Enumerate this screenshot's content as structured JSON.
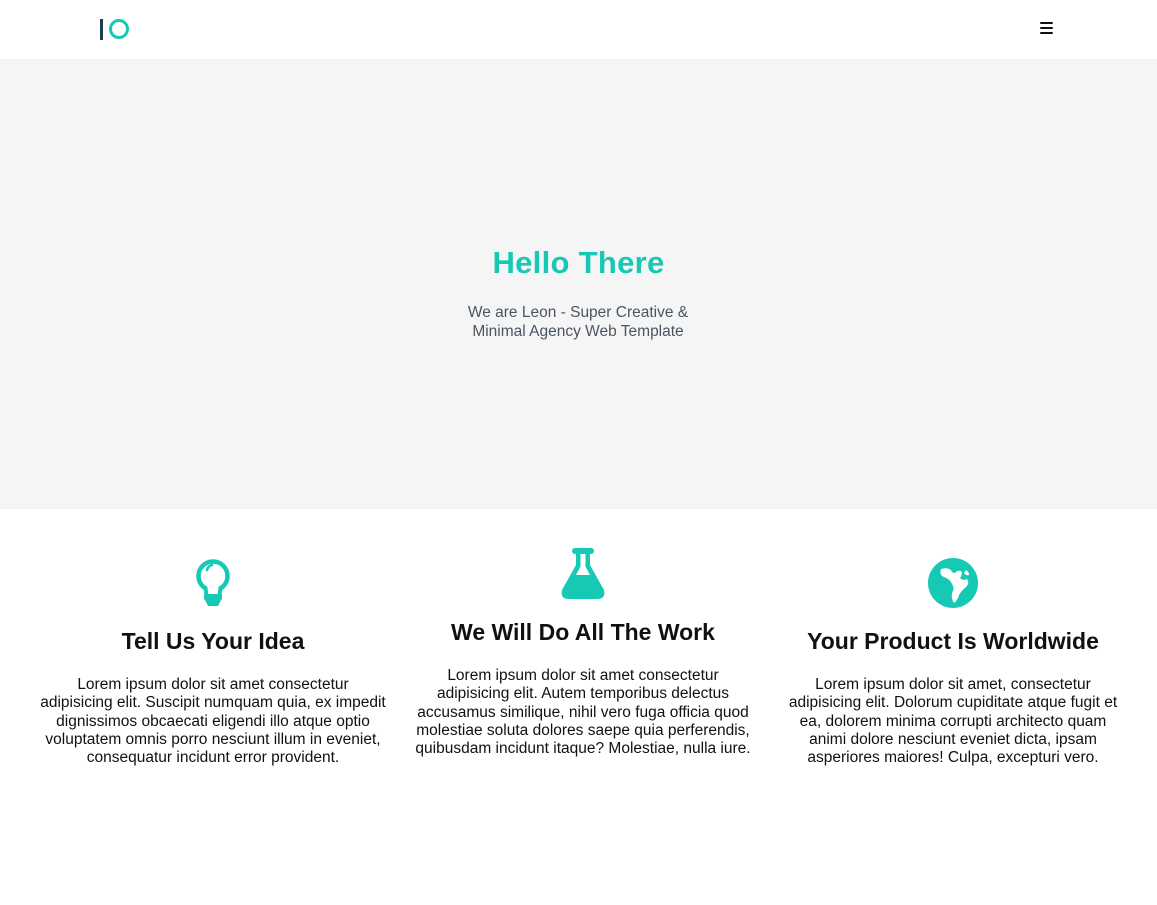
{
  "brand": {
    "accent_color": "#16c9b4",
    "logo_icon": "io-logo"
  },
  "nav": {
    "menu_icon": "hamburger-icon"
  },
  "hero": {
    "title": "Hello There",
    "subtitle_line1": "We are Leon - Super Creative &",
    "subtitle_line2": "Minimal Agency Web Template"
  },
  "features": [
    {
      "icon": "lightbulb-icon",
      "title": "Tell Us Your Idea",
      "text": "Lorem ipsum dolor sit amet consectetur adipisicing elit. Suscipit numquam quia, ex impedit dignissimos obcaecati eligendi illo atque optio voluptatem omnis porro nesciunt illum in eveniet, consequatur incidunt error provident."
    },
    {
      "icon": "flask-icon",
      "title": "We Will Do All The Work",
      "text": "Lorem ipsum dolor sit amet consectetur adipisicing elit. Autem temporibus delectus accusamus similique, nihil vero fuga officia quod molestiae soluta dolores saepe quia perferendis, quibusdam incidunt itaque? Molestiae, nulla iure."
    },
    {
      "icon": "globe-icon",
      "title": "Your Product Is Worldwide",
      "text": "Lorem ipsum dolor sit amet, consectetur adipisicing elit. Dolorum cupiditate atque fugit et ea, dolorem minima corrupti architecto quam animi dolore nesciunt eveniet dicta, ipsam asperiores maiores! Culpa, excepturi vero."
    }
  ]
}
